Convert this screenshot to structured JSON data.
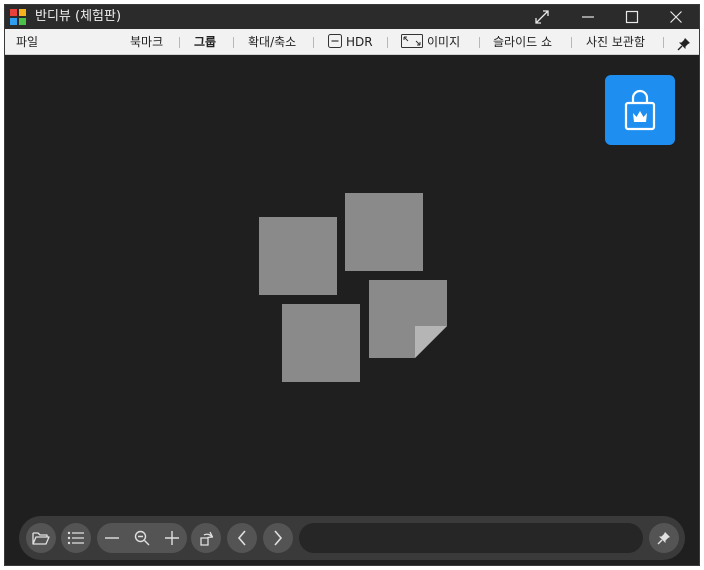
{
  "window": {
    "title": "반디뷰 (체험판)"
  },
  "menu": {
    "file": "파일",
    "bookmark": "북마크",
    "group": "그룹",
    "zoom": "확대/축소",
    "hdr": "HDR",
    "image": "이미지",
    "slideshow": "슬라이드 쇼",
    "photo_storage": "사진 보관함"
  },
  "viewer": {
    "placeholder_icon": "stacked-photos-icon",
    "store_icon": "shopping-bag-crown-icon"
  },
  "bottombar": {
    "path_value": "",
    "icons": [
      "open-folder-icon",
      "list-icon",
      "zoom-out-icon",
      "zoom-fit-icon",
      "zoom-in-icon",
      "rotate-icon",
      "previous-icon",
      "next-icon",
      "pin-icon"
    ]
  },
  "colors": {
    "accent": "#1e8ff0",
    "background": "#1f1f1f",
    "titlebar": "#2b2b2b",
    "menubar": "#f2f2f2"
  }
}
